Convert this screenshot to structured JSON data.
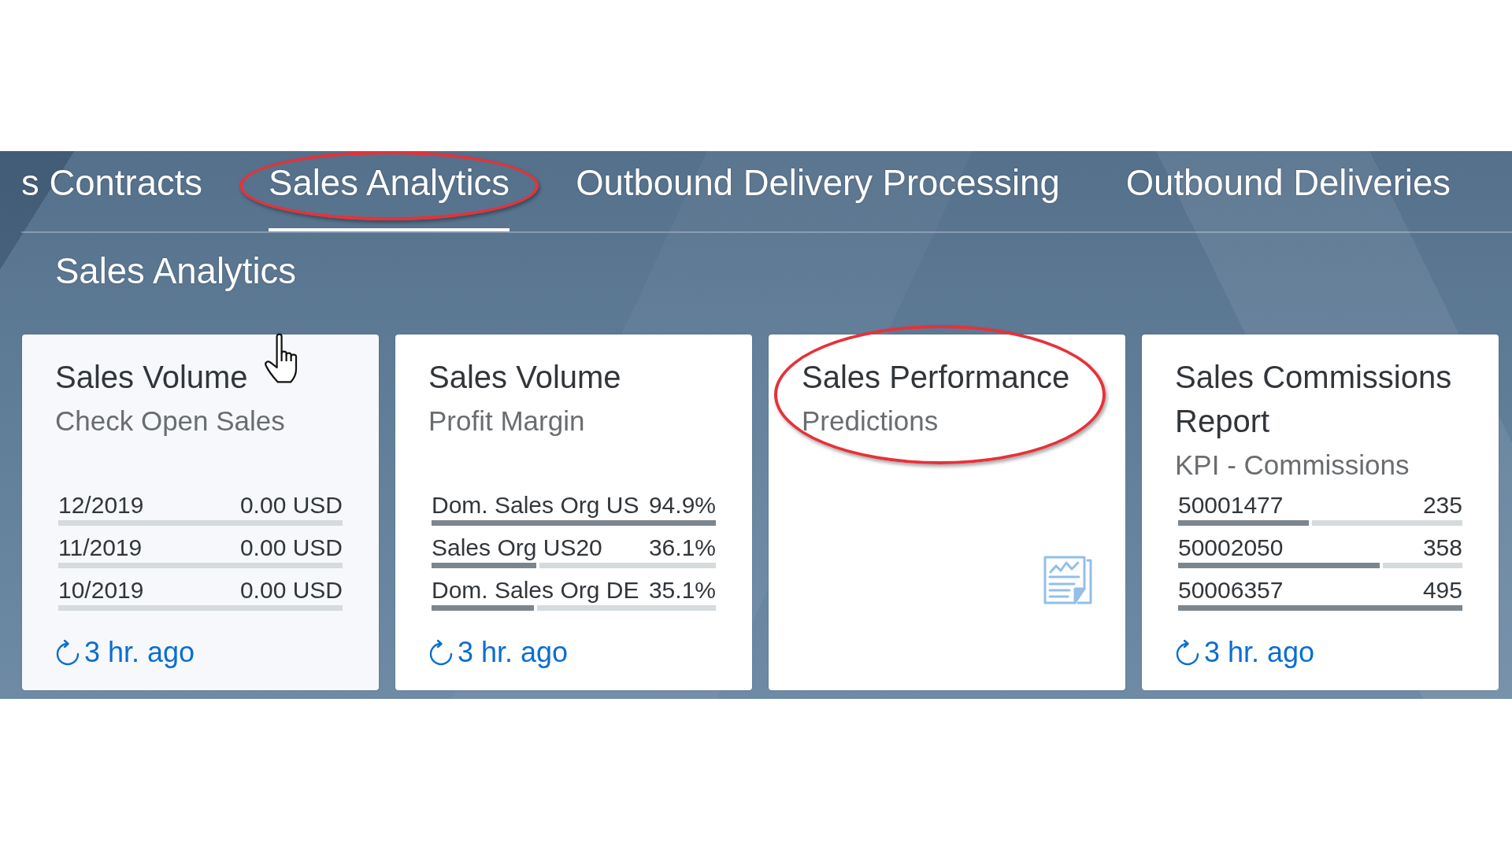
{
  "tab_bar": {
    "tabs": [
      {
        "label": "s Contracts",
        "selected": false,
        "highlighted": false
      },
      {
        "label": "Sales Analytics",
        "selected": true,
        "highlighted": true
      },
      {
        "label": "Outbound Delivery Processing",
        "selected": false,
        "highlighted": false
      },
      {
        "label": "Outbound Deliveries",
        "selected": false,
        "highlighted": false
      }
    ]
  },
  "section": {
    "title": "Sales Analytics"
  },
  "tiles": [
    {
      "kind": "list",
      "title": "Sales Volume",
      "subtitle": "Check Open Sales",
      "hovered": true,
      "highlighted": false,
      "rows": [
        {
          "label": "12/2019",
          "value": "0.00 USD",
          "level": 0
        },
        {
          "label": "11/2019",
          "value": "0.00 USD",
          "level": 0
        },
        {
          "label": "10/2019",
          "value": "0.00 USD",
          "level": 0
        }
      ],
      "footer": "3 hr. ago"
    },
    {
      "kind": "list",
      "title": "Sales Volume",
      "subtitle": "Profit Margin",
      "hovered": false,
      "highlighted": false,
      "rows": [
        {
          "label": "Dom. Sales Org US",
          "value": "94.9%",
          "level": 1
        },
        {
          "label": "Sales Org US20",
          "value": "36.1%",
          "level": 0.38
        },
        {
          "label": "Dom. Sales Org DE",
          "value": "35.1%",
          "level": 0.37
        }
      ],
      "footer": "3 hr. ago"
    },
    {
      "kind": "icon",
      "title": "Sales Performance",
      "subtitle": "Predictions",
      "hovered": false,
      "highlighted": true
    },
    {
      "kind": "list",
      "title": "Sales Commissions Report",
      "subtitle": "KPI - Commissions",
      "hovered": false,
      "highlighted": false,
      "rows": [
        {
          "label": "50001477",
          "value": "235",
          "level": 0.47
        },
        {
          "label": "50002050",
          "value": "358",
          "level": 0.72
        },
        {
          "label": "50006357",
          "value": "495",
          "level": 1
        }
      ],
      "footer": "3 hr. ago"
    }
  ]
}
